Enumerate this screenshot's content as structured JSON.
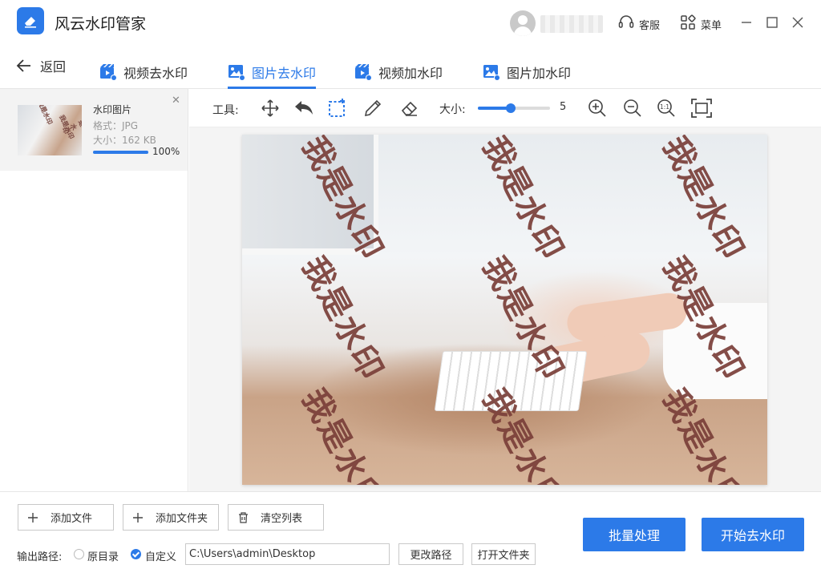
{
  "app": {
    "title": "风云水印管家"
  },
  "header": {
    "service_label": "客服",
    "menu_label": "菜单"
  },
  "nav": {
    "back_label": "返回",
    "tabs": [
      {
        "label": "视频去水印",
        "icon": "video-icon",
        "active": false
      },
      {
        "label": "图片去水印",
        "icon": "image-icon",
        "active": true
      },
      {
        "label": "视频加水印",
        "icon": "video-icon",
        "active": false
      },
      {
        "label": "图片加水印",
        "icon": "image-icon",
        "active": false
      }
    ]
  },
  "file_list": {
    "items": [
      {
        "name": "水印图片",
        "format": "格式：JPG",
        "size": "大小：162 KB",
        "progress": 100,
        "progress_text": "100%"
      }
    ]
  },
  "toolbar": {
    "tools_label": "工具:",
    "size_label": "大小:",
    "size_value": "5",
    "size_fraction": 0.45
  },
  "canvas": {
    "watermark_text": "我是水印"
  },
  "bottom": {
    "add_file": "添加文件",
    "add_folder": "添加文件夹",
    "clear_list": "清空列表",
    "output_label": "输出路径:",
    "radio_original": "原目录",
    "radio_custom": "自定义",
    "output_path": "C:\\Users\\admin\\Desktop",
    "change_path": "更改路径",
    "open_folder": "打开文件夹",
    "batch": "批量处理",
    "start": "开始去水印"
  },
  "colors": {
    "accent": "#2c7ae8",
    "watermark": "#7a3f39"
  }
}
